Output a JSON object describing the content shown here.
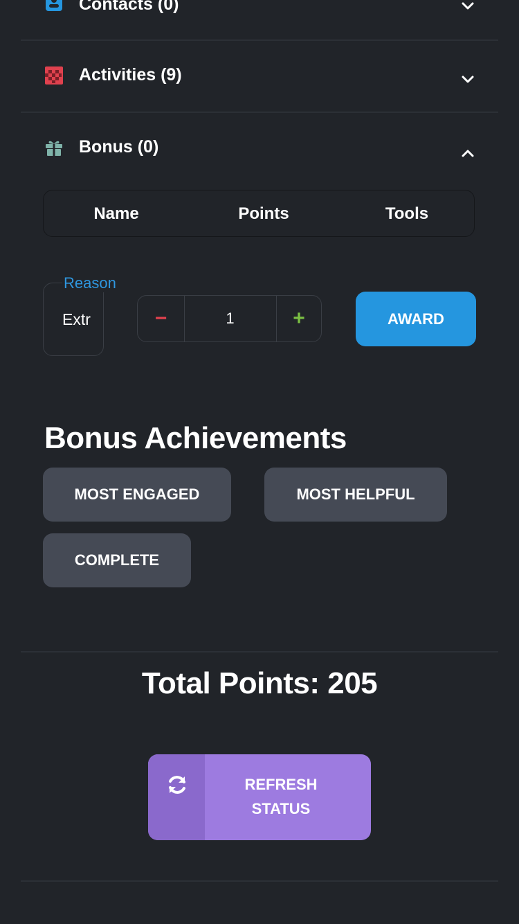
{
  "sections": {
    "contacts": {
      "label": "Contacts (0)",
      "icon": "contact-card-icon",
      "color": "#2596df"
    },
    "activities": {
      "label": "Activities (9)",
      "icon": "checkered-grid-icon",
      "color": "#e0414e"
    },
    "bonus": {
      "label": "Bonus (0)",
      "icon": "gift-icon",
      "color": "#7fb3a9"
    }
  },
  "bonus_table": {
    "columns": [
      "Name",
      "Points",
      "Tools"
    ]
  },
  "award_form": {
    "reason_label": "Reason",
    "reason_value": "Extr",
    "quantity": "1",
    "minus": "−",
    "plus": "+",
    "award_label": "AWARD"
  },
  "achievements": {
    "title": "Bonus Achievements",
    "items": [
      "MOST ENGAGED",
      "MOST HELPFUL",
      "COMPLETE"
    ]
  },
  "total": {
    "text": "Total Points: 205"
  },
  "refresh": {
    "line1": "REFRESH",
    "line2": "STATUS",
    "icon": "refresh-icon"
  },
  "colors": {
    "background": "#212429",
    "accent_blue": "#2596df",
    "minus_red": "#e0414e",
    "plus_green": "#7bc043",
    "chip_gray": "#454a55",
    "refresh_purple": "#9d7be0"
  }
}
